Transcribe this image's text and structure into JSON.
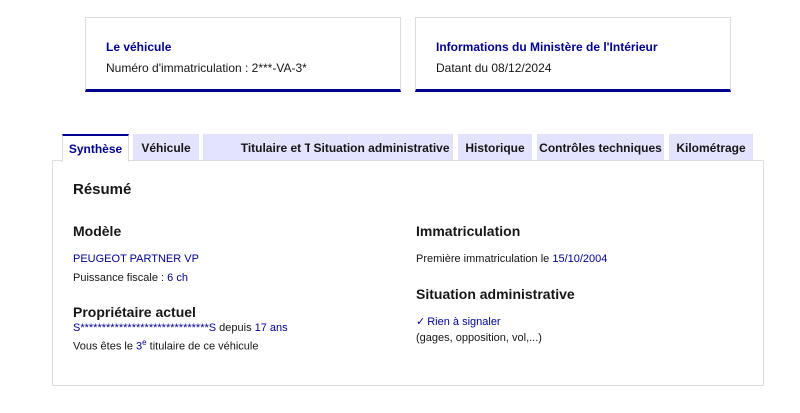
{
  "vehicle_card": {
    "title": "Le véhicule",
    "plate_label": "Numéro d'immatriculation : ",
    "plate_value": "2***-VA-3*"
  },
  "ministry_card": {
    "title": "Informations du Ministère de l'Intérieur",
    "date_text": "Datant du 08/12/2024"
  },
  "tabs": [
    {
      "label": "Synthèse",
      "active": true
    },
    {
      "label": "Véhicule",
      "active": false
    },
    {
      "label": "Titulaire et Titre",
      "active": false
    },
    {
      "label": "Situation administrative",
      "active": false
    },
    {
      "label": "Historique",
      "active": false
    },
    {
      "label": "Contrôles techniques",
      "active": false
    },
    {
      "label": "Kilométrage",
      "active": false
    }
  ],
  "summary": {
    "title": "Résumé",
    "model": {
      "heading": "Modèle",
      "name": "PEUGEOT PARTNER VP",
      "power_label": "Puissance fiscale : ",
      "power_value": "6 ch"
    },
    "owner": {
      "heading": "Propriétaire actuel",
      "name": "S******************************S",
      "since_label": " depuis ",
      "since_value": "17 ans",
      "rank_prefix": "Vous êtes le ",
      "rank_number": "3",
      "rank_suffix": "e",
      "rank_rest": " titulaire de ce véhicule"
    },
    "registration": {
      "heading": "Immatriculation",
      "first_label": "Première immatriculation le ",
      "first_date": "15/10/2004"
    },
    "admin": {
      "heading": "Situation administrative",
      "status": "Rien à signaler",
      "details": "(gages, opposition, vol,...)"
    }
  },
  "colors": {
    "accent": "#000091",
    "tab_bg": "#e3e3fd",
    "border": "#dddddd"
  }
}
